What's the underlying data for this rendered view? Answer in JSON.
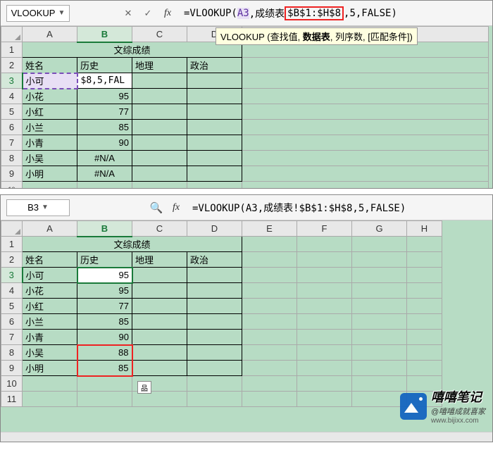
{
  "panel1": {
    "namebox": "VLOOKUP",
    "fx_label": "fx",
    "formula_prefix": "=VLOOKUP(",
    "formula_a3": "A3",
    "formula_mid1": ",成绩表",
    "formula_range": "$B$1:$H$8",
    "formula_suffix": ",5,FALSE)",
    "tooltip_func": "VLOOKUP",
    "tooltip_open": " (查找值, ",
    "tooltip_bold": "数据表",
    "tooltip_close": ", 列序数, [匹配条件])",
    "colA": "A",
    "colB": "B",
    "colC": "C",
    "colD": "D",
    "title": "文综成绩",
    "h_name": "姓名",
    "h_hist": "历史",
    "h_geo": "地理",
    "h_pol": "政治",
    "r3_name": "小可",
    "r3_val": "$8,5,FAL",
    "r4_name": "小花",
    "r4_val": "95",
    "r5_name": "小红",
    "r5_val": "77",
    "r6_name": "小兰",
    "r6_val": "85",
    "r7_name": "小青",
    "r7_val": "90",
    "r8_name": "小吴",
    "r8_val": "#N/A",
    "r9_name": "小明",
    "r9_val": "#N/A"
  },
  "panel2": {
    "namebox": "B3",
    "fx_label": "fx",
    "formula": "=VLOOKUP(A3,成绩表!$B$1:$H$8,5,FALSE)",
    "colA": "A",
    "colB": "B",
    "colC": "C",
    "colD": "D",
    "colE": "E",
    "colF": "F",
    "colG": "G",
    "colH": "H",
    "title": "文综成绩",
    "h_name": "姓名",
    "h_hist": "历史",
    "h_geo": "地理",
    "h_pol": "政治",
    "r3_name": "小可",
    "r3_val": "95",
    "r4_name": "小花",
    "r4_val": "95",
    "r5_name": "小红",
    "r5_val": "77",
    "r6_name": "小兰",
    "r6_val": "85",
    "r7_name": "小青",
    "r7_val": "90",
    "r8_name": "小吴",
    "r8_val": "88",
    "r9_name": "小明",
    "r9_val": "85",
    "paste_icon": "品"
  },
  "watermark": {
    "title": "嘻嘻笔记",
    "sub": "@嘻嘻成就喜家",
    "url": "www.bijixx.com"
  }
}
